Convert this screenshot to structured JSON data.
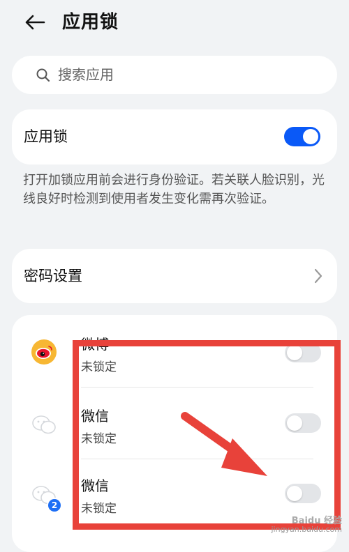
{
  "header": {
    "title": "应用锁",
    "back_icon": "arrow-left-icon"
  },
  "search": {
    "placeholder": "搜索应用",
    "icon": "search-icon"
  },
  "applock": {
    "label": "应用锁",
    "enabled": true
  },
  "description": "打开加锁应用前会进行身份验证。若关联人脸识别，光线良好时检测到使用者发生变化需再次验证。",
  "password_settings": {
    "label": "密码设置",
    "chevron_icon": "chevron-right-icon"
  },
  "apps": [
    {
      "name": "微博",
      "status": "未锁定",
      "icon": "weibo-icon",
      "locked": false
    },
    {
      "name": "微信",
      "status": "未锁定",
      "icon": "wechat-icon",
      "locked": false
    },
    {
      "name": "微信",
      "status": "未锁定",
      "icon": "wechat-clone-icon",
      "locked": false,
      "badge": "2"
    }
  ],
  "watermark": {
    "line1": "Baidu 经验",
    "line2": "jingyan.baidu.com"
  },
  "colors": {
    "accent": "#0a59f7",
    "annotation": "#e8423a",
    "background": "#f1f3f5"
  }
}
